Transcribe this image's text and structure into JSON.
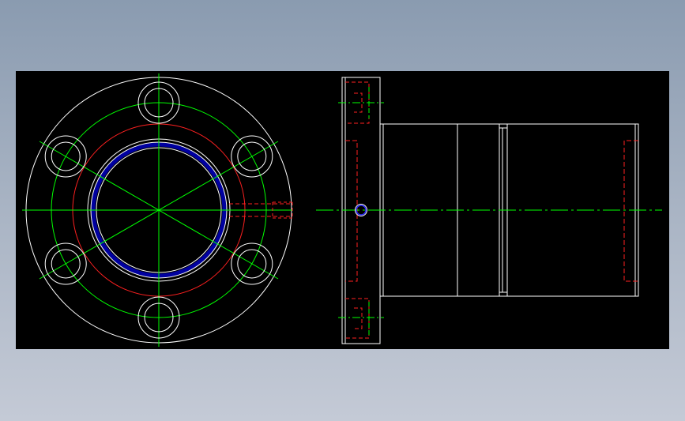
{
  "drawing": {
    "background": "#000000",
    "colors": {
      "outline": "#ffffff",
      "centerline": "#00ff00",
      "hidden": "#ff2020",
      "pitch_red": "#ff2020",
      "bore_fill": "#0000a0",
      "ring_blue": "#0000ff"
    },
    "front_view": {
      "bolt_hole_count": 6
    },
    "side_view": {
      "has_grease_hole": true
    }
  }
}
